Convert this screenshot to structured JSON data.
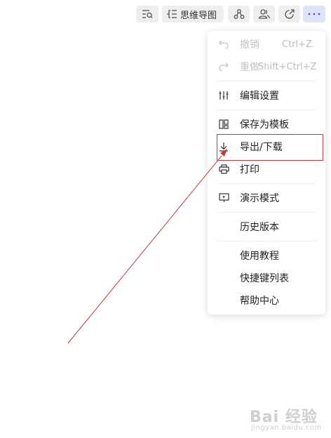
{
  "toolbar": {
    "mindmap_label": "思维导图"
  },
  "menu": {
    "undo": {
      "label": "撤销",
      "shortcut": "Ctrl+Z"
    },
    "redo": {
      "label": "重做",
      "shortcut": "Shift+Ctrl+Z"
    },
    "edit_settings": {
      "label": "编辑设置"
    },
    "save_template": {
      "label": "保存为模板"
    },
    "export_download": {
      "label": "导出/下载"
    },
    "print": {
      "label": "打印"
    },
    "present": {
      "label": "演示模式"
    },
    "history": {
      "label": "历史版本"
    },
    "tutorial": {
      "label": "使用教程"
    },
    "shortcuts": {
      "label": "快捷键列表"
    },
    "help": {
      "label": "帮助中心"
    }
  },
  "watermark": {
    "brand": "Bai 经验",
    "url": "jingyan.baidu.com"
  },
  "colors": {
    "accent_more_button": "#dfe3f7",
    "annotation_red": "#c23a3a"
  }
}
